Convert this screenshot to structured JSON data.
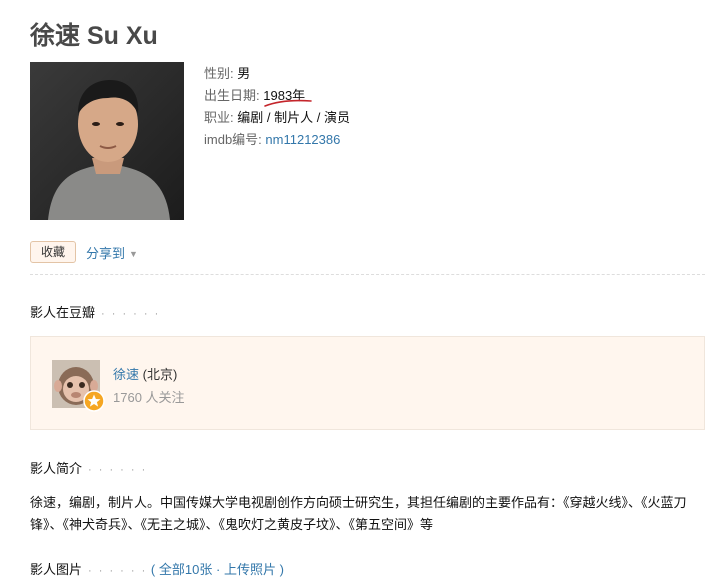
{
  "title": "徐速 Su Xu",
  "profile": {
    "gender_label": "性别:",
    "gender": "男",
    "birth_label": "出生日期:",
    "birth": "1983年",
    "job_label": "职业:",
    "jobs": [
      "编剧",
      "制片人",
      "演员"
    ],
    "job_sep": " / ",
    "imdb_label": "imdb编号:",
    "imdb": "nm11212386"
  },
  "actions": {
    "collect": "收藏",
    "share": "分享到",
    "share_caret": "▼"
  },
  "douban_section": {
    "heading": "影人在豆瓣",
    "dots": "· · · · · ·",
    "name": "徐速",
    "location": "(北京)",
    "followers": "1760 人关注"
  },
  "intro_section": {
    "heading": "影人简介",
    "dots": "· · · · · ·",
    "text": "徐速，编剧，制片人。中国传媒大学电视剧创作方向硕士研究生，其担任编剧的主要作品有：《穿越火线》、《火蓝刀锋》、《神犬奇兵》、《无主之城》、《鬼吹灯之黄皮子坟》、《第五空间》等"
  },
  "photos_section": {
    "heading": "影人图片",
    "dots": "· · · · · ·",
    "open_paren": "(",
    "all": "全部10张",
    "mid_sep": "·",
    "upload": "上传照片",
    "close_paren": ")"
  }
}
